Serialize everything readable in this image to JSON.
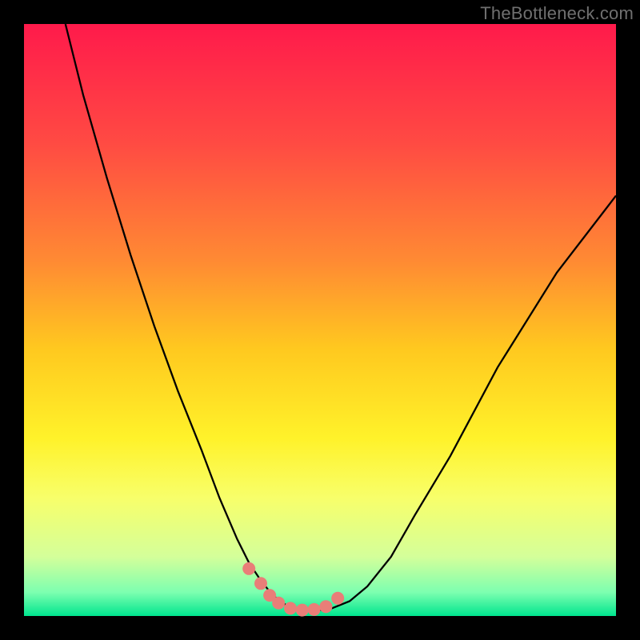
{
  "watermark": "TheBottleneck.com",
  "chart_data": {
    "type": "line",
    "title": "",
    "xlabel": "",
    "ylabel": "",
    "xlim": [
      0,
      100
    ],
    "ylim": [
      0,
      100
    ],
    "background_gradient": {
      "stops": [
        {
          "offset": 0.0,
          "color": "#ff1a4b"
        },
        {
          "offset": 0.2,
          "color": "#ff4a43"
        },
        {
          "offset": 0.4,
          "color": "#ff8a33"
        },
        {
          "offset": 0.55,
          "color": "#ffc91f"
        },
        {
          "offset": 0.7,
          "color": "#fff22a"
        },
        {
          "offset": 0.8,
          "color": "#f8ff6a"
        },
        {
          "offset": 0.9,
          "color": "#d4ff9a"
        },
        {
          "offset": 0.96,
          "color": "#7dffb0"
        },
        {
          "offset": 1.0,
          "color": "#00e58e"
        }
      ]
    },
    "series": [
      {
        "name": "bottleneck-curve",
        "color": "#000000",
        "x": [
          7,
          10,
          14,
          18,
          22,
          26,
          30,
          33,
          36,
          38,
          40,
          42,
          44,
          46,
          48,
          50,
          52,
          55,
          58,
          62,
          66,
          72,
          80,
          90,
          100
        ],
        "y": [
          100,
          88,
          74,
          61,
          49,
          38,
          28,
          20,
          13,
          9,
          6,
          3.5,
          2,
          1.3,
          1,
          1,
          1.3,
          2.5,
          5,
          10,
          17,
          27,
          42,
          58,
          71
        ]
      }
    ],
    "markers": {
      "name": "highlight-points",
      "color": "#e97e78",
      "radius_px": 8,
      "x": [
        38,
        40,
        41.5,
        43,
        45,
        47,
        49,
        51,
        53
      ],
      "y": [
        8,
        5.5,
        3.5,
        2.2,
        1.3,
        1.0,
        1.1,
        1.6,
        3.0
      ]
    }
  }
}
